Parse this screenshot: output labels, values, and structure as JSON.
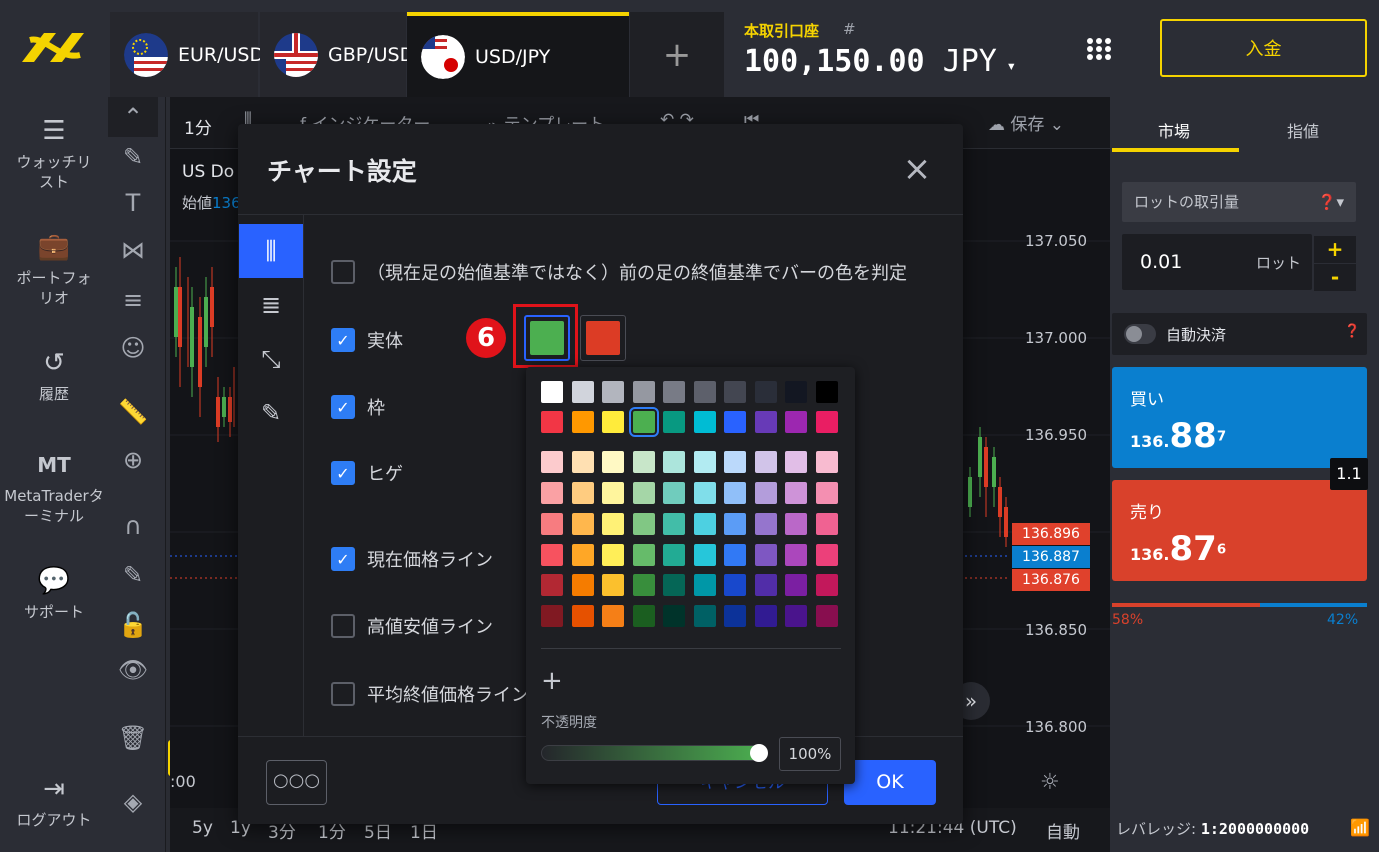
{
  "tabs": [
    {
      "label": "EUR/USD"
    },
    {
      "label": "GBP/USD"
    },
    {
      "label": "USD/JPY"
    }
  ],
  "account": {
    "type": "本取引口座",
    "num": "#",
    "balance": "100,150.00",
    "currency": "JPY"
  },
  "deposit_label": "入金",
  "nav": {
    "watchlist": "ウォッチリスト",
    "portfolio": "ポートフォリオ",
    "history": "履歴",
    "mt_icon": "MT",
    "mt": "MetaTraderターミナル",
    "support": "サポート",
    "logout": "ログアウト"
  },
  "chart_toolbar": {
    "interval": "1分",
    "indicators": "インジケーター",
    "templates": "テンプレート",
    "save": "保存"
  },
  "chart_header": {
    "symbol": "US Do",
    "open_label": "始値",
    "open_val": "136"
  },
  "price_axis": [
    "137.050",
    "137.000",
    "136.950",
    "136.850",
    "136.800"
  ],
  "price_tags": [
    {
      "val": "136.896",
      "color": "#e0412c"
    },
    {
      "val": "136.887",
      "color": "#0a7fcf"
    },
    {
      "val": "136.876",
      "color": "#e0412c"
    }
  ],
  "time_tick": ":00",
  "bottom_bar": {
    "ranges": [
      "5y",
      "1y",
      "3分",
      "1分",
      "5日",
      "1日"
    ],
    "time": "11:21:44 (UTC)",
    "auto": "自動",
    "leverage_label": "レバレッジ:",
    "leverage_val": "1:2000000000"
  },
  "right_panel": {
    "tab_market": "市場",
    "tab_limit": "指値",
    "order_type": "ロットの取引量",
    "lot_value": "0.01",
    "lot_unit": "ロット",
    "plus": "+",
    "minus": "-",
    "auto_close": "自動決済",
    "buy_label": "買い",
    "buy_price_a": "136.",
    "buy_price_b": "88",
    "buy_price_c": "7",
    "sell_label": "売り",
    "sell_price_a": "136.",
    "sell_price_b": "87",
    "sell_price_c": "6",
    "spread": "1.1",
    "sell_pct": "58%",
    "buy_pct": "42%"
  },
  "sentiment": {
    "sell_pct": 58,
    "buy_pct": 42
  },
  "modal": {
    "title": "チャート設定",
    "options": [
      {
        "label": "（現在足の始値基準ではなく）前の足の終値基準でバーの色を判定",
        "checked": false
      },
      {
        "label": "実体",
        "checked": true
      },
      {
        "label": "枠",
        "checked": true
      },
      {
        "label": "ヒゲ",
        "checked": true
      },
      {
        "label": "現在価格ライン",
        "checked": true
      },
      {
        "label": "高値安値ライン",
        "checked": false
      },
      {
        "label": "平均終値価格ライン",
        "checked": false
      }
    ],
    "step_number": "6",
    "more": "○○○",
    "cancel": "キャンセル",
    "ok": "OK"
  },
  "picker": {
    "opacity_label": "不透明度",
    "opacity_value": "100%",
    "opacity": 1.0,
    "rows": [
      [
        "#ffffff",
        "#d1d4dc",
        "#b2b5be",
        "#9598a1",
        "#787b86",
        "#5d606b",
        "#434651",
        "#2a2e39",
        "#131722",
        "#000000"
      ],
      [
        "#f23645",
        "#ff9800",
        "#ffeb3b",
        "#4caf50",
        "#089981",
        "#00bcd4",
        "#2962ff",
        "#673ab7",
        "#9c27b0",
        "#e91e63"
      ],
      [
        "#fccbcd",
        "#ffe0b2",
        "#fff9c4",
        "#c8e6c9",
        "#ace5dc",
        "#b2ebf2",
        "#bbd9fb",
        "#d1c4e9",
        "#e1bee7",
        "#f8bbd0"
      ],
      [
        "#faa1a4",
        "#ffcc80",
        "#fff59d",
        "#a5d6a7",
        "#70ccbd",
        "#80deea",
        "#90bff9",
        "#b39ddb",
        "#ce93d8",
        "#f48fb1"
      ],
      [
        "#f77c80",
        "#ffb74d",
        "#fff176",
        "#81c784",
        "#42bda8",
        "#4dd0e1",
        "#5b9cf6",
        "#9575cd",
        "#ba68c8",
        "#f06292"
      ],
      [
        "#f7525f",
        "#ffa726",
        "#ffee58",
        "#66bb6a",
        "#22ab94",
        "#26c6da",
        "#3179f5",
        "#7e57c2",
        "#ab47bc",
        "#ec407a"
      ],
      [
        "#b22833",
        "#f57c00",
        "#fbc02d",
        "#388e3c",
        "#056656",
        "#0097a7",
        "#1848cc",
        "#512da8",
        "#7b1fa2",
        "#c2185b"
      ],
      [
        "#801922",
        "#e65100",
        "#f57f17",
        "#1b5e20",
        "#00332a",
        "#006064",
        "#0c3299",
        "#311b92",
        "#4a148c",
        "#880e4f"
      ]
    ],
    "selected": "#4caf50"
  },
  "colors": {
    "accent": "#f5d300",
    "brand_blue": "#2962ff",
    "buy": "#0a7fcf",
    "sell": "#d9412b",
    "body_up": "#4caf50",
    "body_down": "#dc3c25"
  }
}
